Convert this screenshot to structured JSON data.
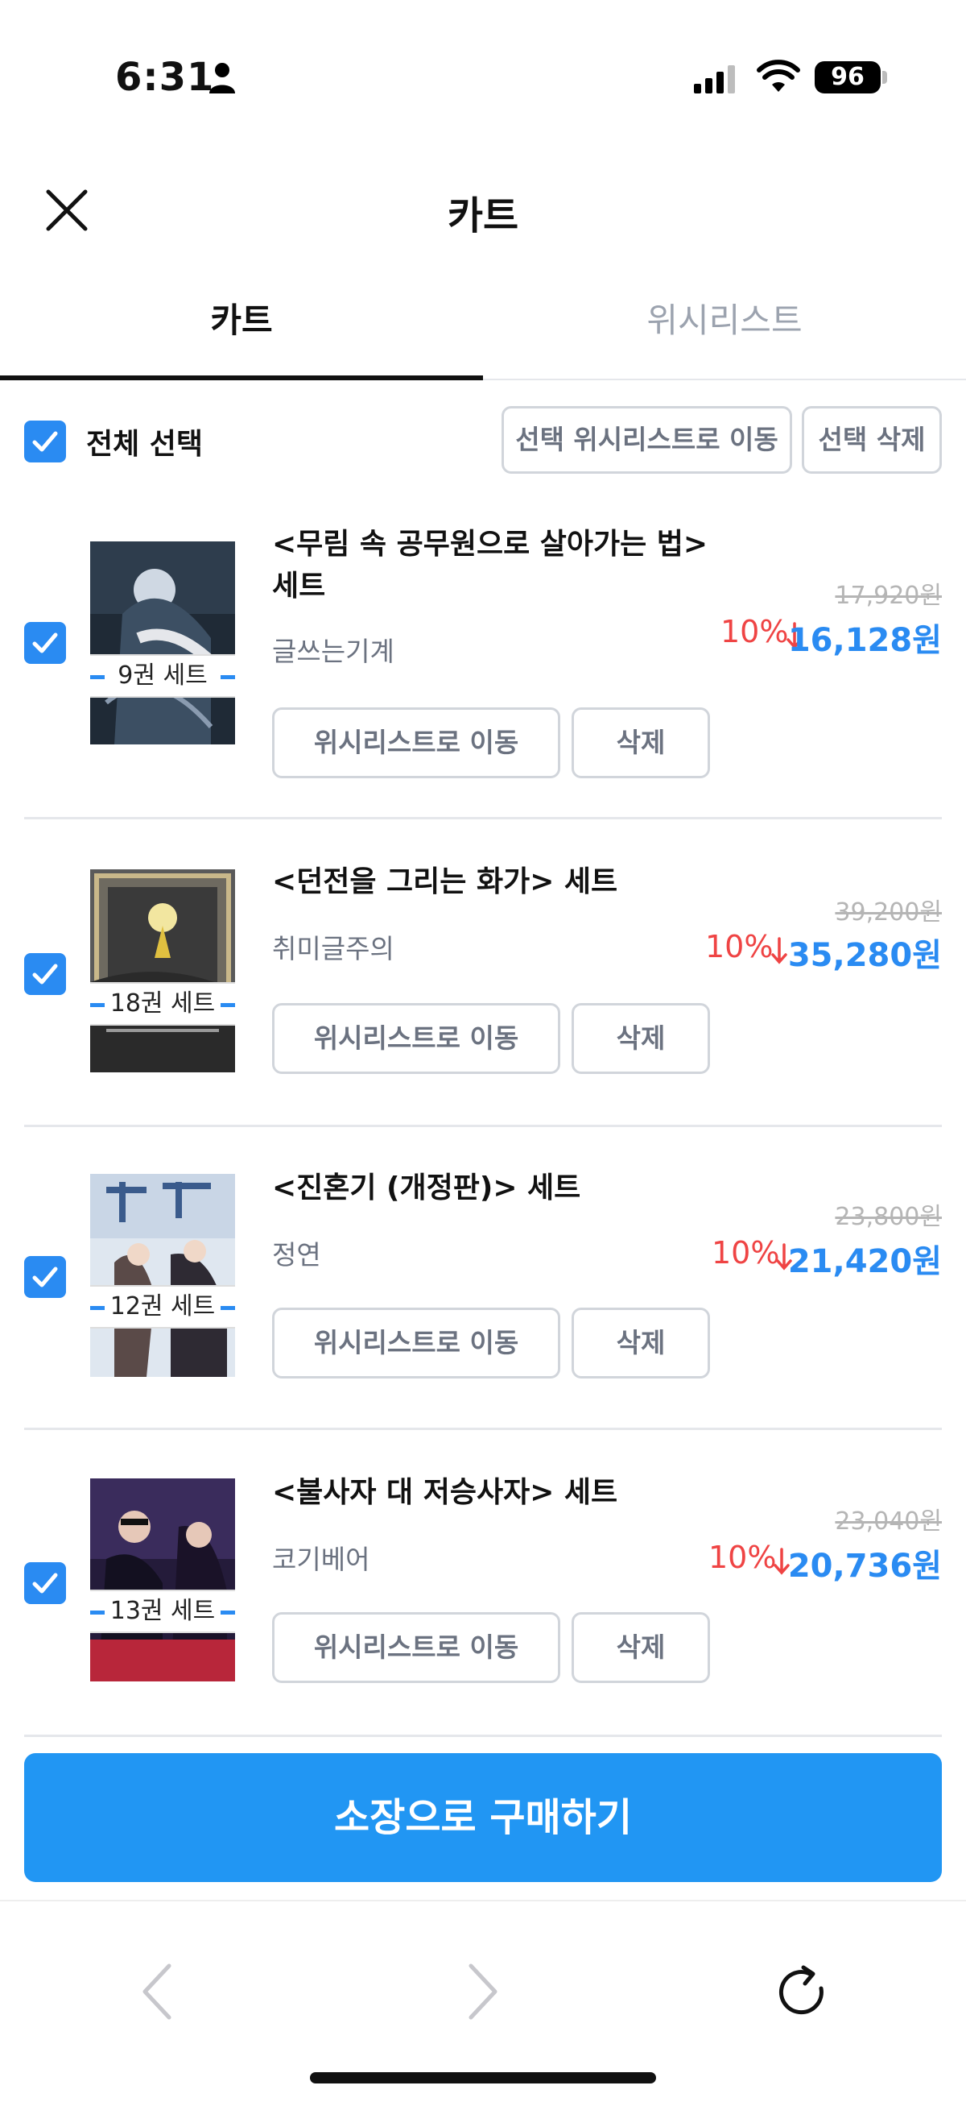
{
  "status_bar": {
    "time": "6:31",
    "battery": "96"
  },
  "header": {
    "title": "카트"
  },
  "tabs": [
    {
      "label": "카트"
    },
    {
      "label": "위시리스트"
    }
  ],
  "toolbar": {
    "select_all_label": "전체 선택",
    "move_selected_label": "선택 위시리스트로 이동",
    "delete_selected_label": "선택 삭제"
  },
  "items": [
    {
      "title": "<무림 속 공무원으로 살아가는 법> 세트",
      "author": "글쓰는기계",
      "set_label": "9권 세트",
      "original_price": "17,920원",
      "discount": "10%",
      "price": "16,128원",
      "wish_label": "위시리스트로 이동",
      "delete_label": "삭제",
      "checked": true
    },
    {
      "title": "<던전을 그리는 화가> 세트",
      "author": "취미글주의",
      "set_label": "18권 세트",
      "original_price": "39,200원",
      "discount": "10%",
      "price": "35,280원",
      "wish_label": "위시리스트로 이동",
      "delete_label": "삭제",
      "checked": true
    },
    {
      "title": "<진혼기 (개정판)> 세트",
      "author": "정연",
      "set_label": "12권 세트",
      "original_price": "23,800원",
      "discount": "10%",
      "price": "21,420원",
      "wish_label": "위시리스트로 이동",
      "delete_label": "삭제",
      "checked": true
    },
    {
      "title": "<불사자 대 저승사자> 세트",
      "author": "코기베어",
      "set_label": "13권 세트",
      "original_price": "23,040원",
      "discount": "10%",
      "price": "20,736원",
      "wish_label": "위시리스트로 이동",
      "delete_label": "삭제",
      "checked": true
    }
  ],
  "purchase": {
    "label": "소장으로 구매하기"
  },
  "colors": {
    "accent": "#2a8bf2",
    "purchase": "#2196f3",
    "discount": "#ef4444"
  }
}
